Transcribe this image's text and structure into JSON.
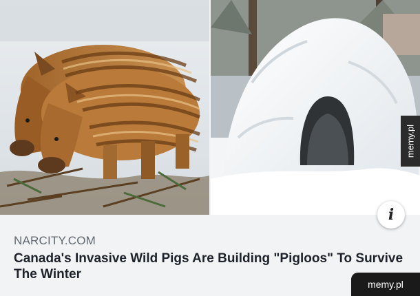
{
  "article": {
    "source": "NARCITY.COM",
    "headline": "Canada's Invasive Wild Pigs Are Building \"Pigloos\" To Survive The Winter"
  },
  "images": {
    "left": "wild-piglets-in-snow",
    "right": "snow-igloo"
  },
  "info_button": {
    "icon": "info-icon",
    "glyph": "i"
  },
  "watermarks": {
    "side": "memy.pl",
    "bottom": "memy.pl"
  }
}
